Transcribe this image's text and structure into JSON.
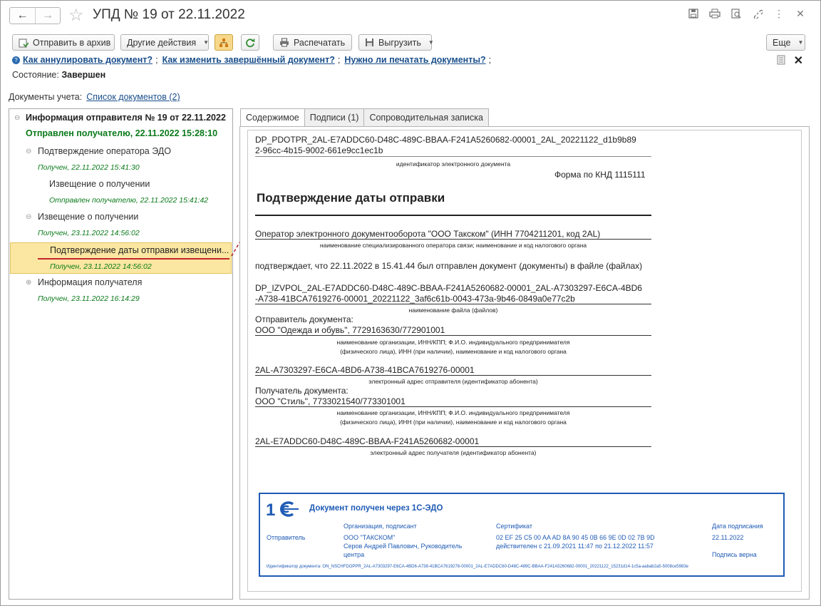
{
  "window": {
    "title": "УПД № 19 от 22.11.2022",
    "nav_back": "←",
    "nav_forward": "→"
  },
  "toolbar": {
    "archive": "Отправить в архив",
    "other_actions": "Другие действия",
    "print": "Распечатать",
    "export": "Выгрузить",
    "more": "Еще"
  },
  "help": {
    "link1": "Как аннулировать документ?",
    "link2": "Как изменить завершённый документ?",
    "link3": "Нужно ли печатать документы?",
    "sep": ";"
  },
  "state": {
    "label": "Состояние:",
    "value": "Завершен"
  },
  "docs": {
    "label": "Документы учета:",
    "link": "Список документов (2)"
  },
  "tree": {
    "root": "Информация отправителя № 19 от 22.11.2022",
    "root_status": "Отправлен получателю, 22.11.2022 15:28:10",
    "n1": "Подтверждение оператора ЭДО",
    "n1_status": "Получен, 22.11.2022 15:41:30",
    "n2": "Извещение о получении",
    "n2_status": "Отправлен получателю, 22.11.2022 15:41:42",
    "n3": "Извещение о получении",
    "n3_status": "Получен, 23.11.2022 14:56:02",
    "n4": "Подтверждение даты отправки извещени...",
    "n4_status": "Получен, 23.11.2022 14:56:02",
    "n5": "Информация получателя",
    "n5_status": "Получен, 23.11.2022 16:14:29"
  },
  "tabs": [
    "Содержимое",
    "Подписи (1)",
    "Сопроводительная записка"
  ],
  "document": {
    "file_id_1": "DP_PDOTPR_2AL-E7ADDC60-D48C-489C-BBAA-F241A5260682-00001_2AL_20221122_d1b9b89",
    "file_id_2": "2-96cc-4b15-9002-661e9cc1ec1b",
    "file_id_caption": "идентификатор электронного документа",
    "form_knd": "Форма по КНД 1115111",
    "heading": "Подтверждение даты отправки",
    "operator": "Оператор электронного документооборота \"ООО Такском\" (ИНН 7704211201, код 2AL)",
    "operator_caption": "наименование специализированного оператора связи; наименование и код налогового органа",
    "confirms": "подтверждает, что 22.11.2022 в 15.41.44 был отправлен документ (документы) в файле (файлах)",
    "filename_1": "DP_IZVPOL_2AL-E7ADDC60-D48C-489C-BBAA-F241A5260682-00001_2AL-A7303297-E6CA-4BD6",
    "filename_2": "-A738-41BCA7619276-00001_20221122_3af6c61b-0043-473a-9b46-0849a0e77c2b",
    "filename_caption": "наименование файла (файлов)",
    "sender_label": "Отправитель документа:",
    "sender": "ООО \"Одежда и обувь\", 7729163630/772901001",
    "org_caption_1": "наименование организации, ИНН/КПП; Ф.И.О. индивидуального предпринимателя",
    "org_caption_2": "(физического лица), ИНН (при наличии), наименование и код налогового органа",
    "sender_addr": "2AL-A7303297-E6CA-4BD6-A738-41BCA7619276-00001",
    "sender_addr_caption": "электронный адрес отправителя (идентификатор абонента)",
    "receiver_label": "Получатель документа:",
    "receiver": "ООО \"Стиль\", 7733021540/773301001",
    "receiver_addr": "2AL-E7ADDC60-D48C-489C-BBAA-F241A5260682-00001",
    "receiver_addr_caption": "электронный адрес получателя (идентификатор абонента)"
  },
  "stamp": {
    "title": "Документ получен через 1С-ЭДО",
    "col_org": "Организация, подписант",
    "col_cert": "Сертификат",
    "col_date": "Дата подписания",
    "row_label": "Отправитель",
    "org": "ООО \"ТАКСКОМ\"",
    "signer_1": "Серов Андрей Павлович, Руководитель",
    "signer_2": "центра",
    "cert": "02 EF 25 C5 00 AA AD 8A 90 45 0B 66 9E 0D 02 7B 9D",
    "cert_valid": "действителен с 21.09.2021 11:47 по 21.12.2022 11:57",
    "date": "22.11.2022",
    "sig_ok": "Подпись верна",
    "doc_id": "Идентификатор документа: ON_NSCHFDOPPR_2AL-A7303297-E6CA-4BD6-A738-41BCA7619276-00001_2AL-E7ADDC60-D48C-489C-BBAA-F241A5260682-00001_20221122_15231d14-1c5a-aabab2a5-5008ce5983e"
  }
}
